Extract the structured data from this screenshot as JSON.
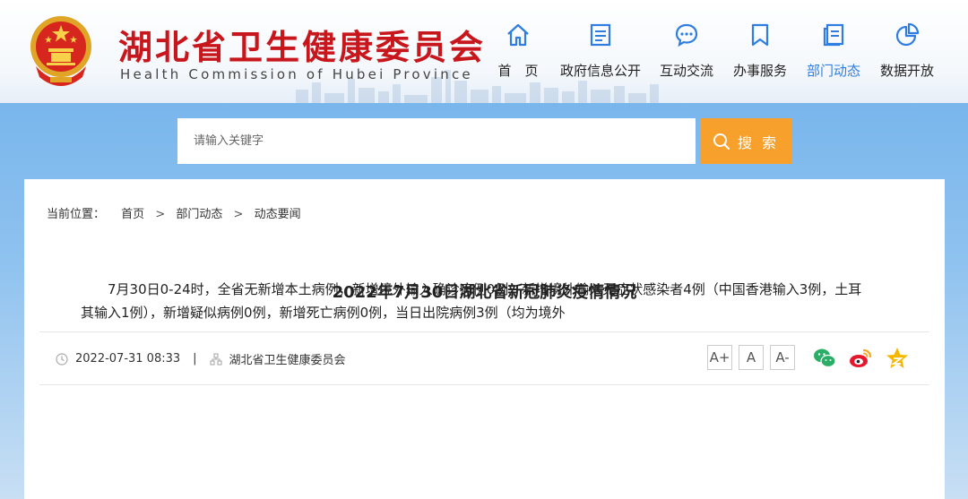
{
  "header": {
    "title": "湖北省卫生健康委员会",
    "subtitle": "Health Commission of Hubei Province",
    "colors": {
      "title": "#c8161d",
      "nav_active": "#2f7de1",
      "nav_icon": "#2f7de1"
    }
  },
  "nav": {
    "items": [
      {
        "label": "首　页",
        "icon": "home-icon"
      },
      {
        "label": "政府信息公开",
        "icon": "document-icon"
      },
      {
        "label": "互动交流",
        "icon": "chat-bubble-icon"
      },
      {
        "label": "办事服务",
        "icon": "bookmark-icon"
      },
      {
        "label": "部门动态",
        "icon": "news-icon",
        "active": true
      },
      {
        "label": "数据开放",
        "icon": "pie-chart-icon"
      }
    ]
  },
  "search": {
    "placeholder": "请输入关键字",
    "button_label": "搜 索",
    "button_color": "#f7a02c"
  },
  "breadcrumb": {
    "label": "当前位置：",
    "items": [
      "首页",
      "部门动态",
      "动态要闻"
    ],
    "separator": ">"
  },
  "article": {
    "title": "2022年7月30日湖北省新冠肺炎疫情情况",
    "date": "2022-07-31 08:33",
    "source": "湖北省卫生健康委员会",
    "font_sizes": [
      "A+",
      "A",
      "A-"
    ],
    "body": "7月30日0-24时，全省无新增本土病例，新增境外输入确诊病例0例，新增境外输入无症状感染者4例（中国香港输入3例，土耳其输入1例），新增疑似病例0例，新增死亡病例0例，当日出院病例3例（均为境外"
  },
  "share": {
    "icons": [
      "wechat-icon",
      "weibo-icon",
      "favorite-star-icon"
    ],
    "colors": {
      "wechat": "#2aae67",
      "weibo": "#e6162d",
      "star": "#f5b800"
    }
  }
}
